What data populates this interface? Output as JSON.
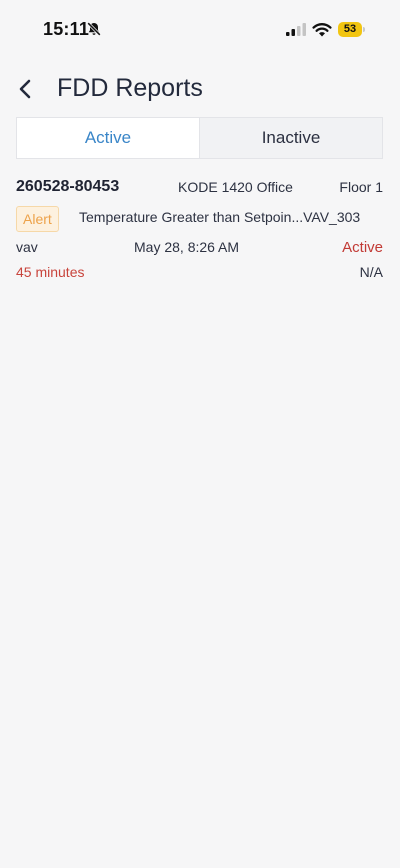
{
  "status_bar": {
    "time": "15:11",
    "battery": "53",
    "colors": {
      "battery": "#f2c511"
    },
    "icons": [
      "bell-off-icon",
      "cellular-signal-icon",
      "wifi-icon",
      "battery-icon"
    ]
  },
  "header": {
    "title": "FDD Reports",
    "back_icon": "chevron-left-icon"
  },
  "tabs": [
    {
      "label": "Active",
      "selected": true
    },
    {
      "label": "Inactive",
      "selected": false
    }
  ],
  "reports": [
    {
      "id": "260528-80453",
      "site": "KODE 1420 Office",
      "floor": "Floor 1",
      "severity": "Alert",
      "description": "Temperature Greater than Setpoin...",
      "equipment": "VAV_303",
      "equipment_type": "vav",
      "timestamp": "May 28, 8:26 AM",
      "status": "Active",
      "duration": "45 minutes",
      "extra": "N/A"
    }
  ],
  "colors": {
    "accent": "#3a86c8",
    "status_active": "#c23a35",
    "alert": "#eda24a"
  }
}
